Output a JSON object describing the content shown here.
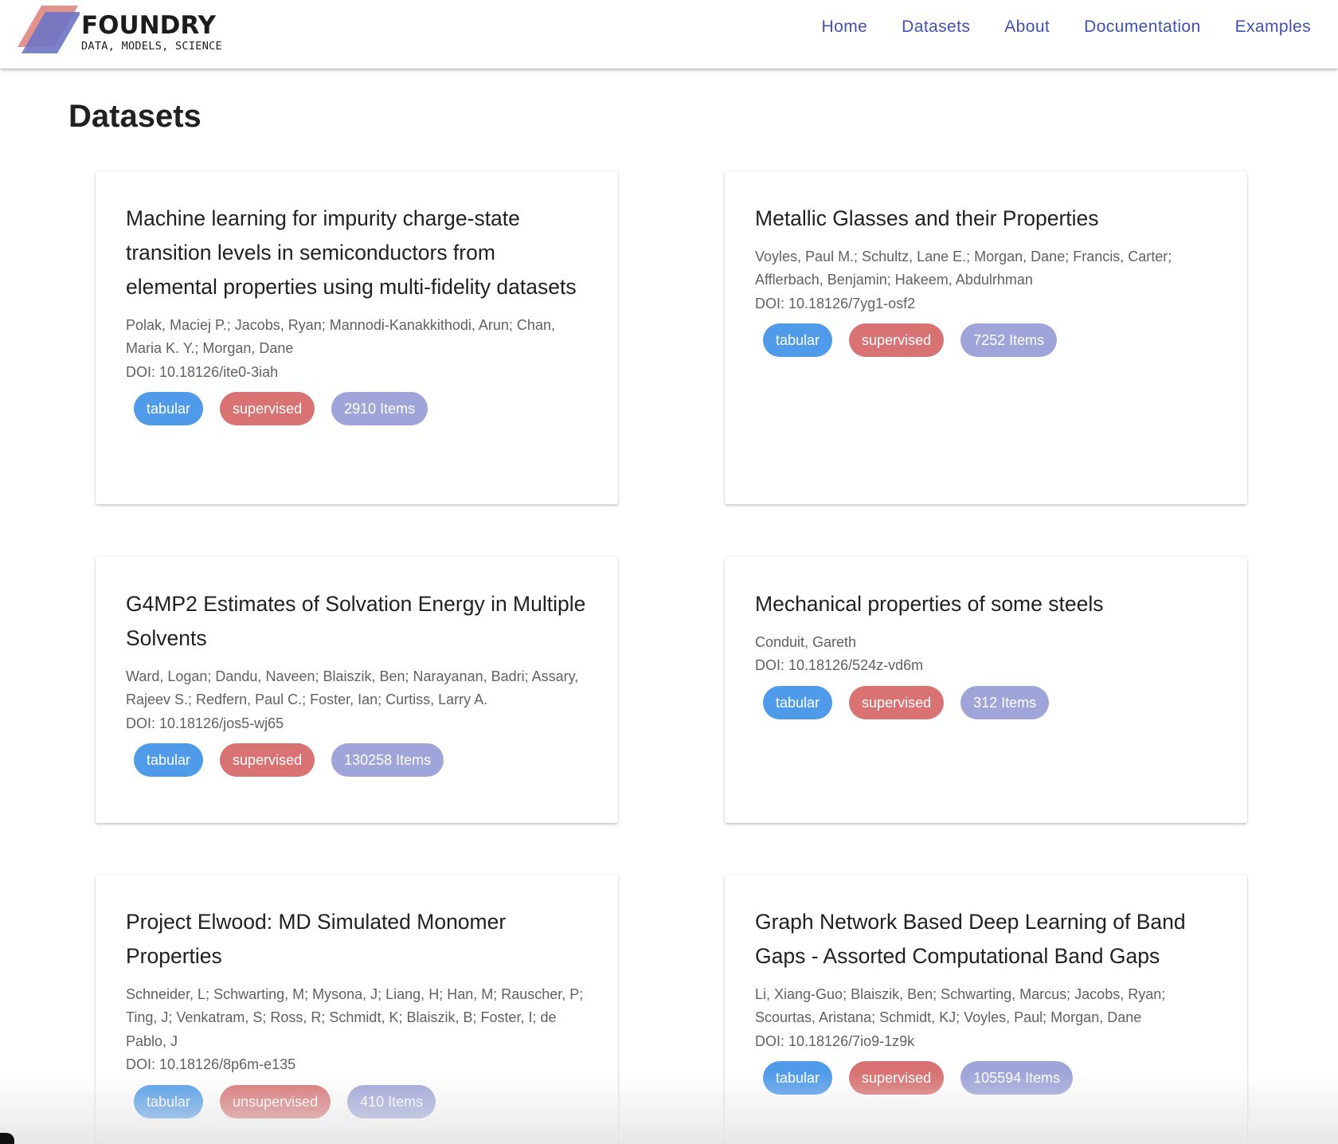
{
  "brand": {
    "name": "FOUNDRY",
    "tagline": "DATA, MODELS, SCIENCE",
    "logo_colors": [
      "#e08580",
      "#6c74c4"
    ]
  },
  "nav": {
    "links": [
      "Home",
      "Datasets",
      "About",
      "Documentation",
      "Examples"
    ]
  },
  "page": {
    "title": "Datasets"
  },
  "datasets": [
    {
      "title": "Machine learning for impurity charge-state transition levels in semiconductors from elemental properties using multi-fidelity datasets",
      "authors": "Polak, Maciej P.; Jacobs, Ryan; Mannodi-Kanakkithodi, Arun; Chan, Maria K. Y.; Morgan, Dane",
      "doi": "DOI: 10.18126/ite0-3iah",
      "type": "tabular",
      "task": "supervised",
      "items": "2910 Items"
    },
    {
      "title": "Metallic Glasses and their Properties",
      "authors": "Voyles, Paul M.; Schultz, Lane E.; Morgan, Dane; Francis, Carter; Afflerbach, Benjamin; Hakeem, Abdulrhman",
      "doi": "DOI: 10.18126/7yg1-osf2",
      "type": "tabular",
      "task": "supervised",
      "items": "7252 Items"
    },
    {
      "title": "G4MP2 Estimates of Solvation Energy in Multiple Solvents",
      "authors": "Ward, Logan; Dandu, Naveen; Blaiszik, Ben; Narayanan, Badri; Assary, Rajeev S.; Redfern, Paul C.; Foster, Ian; Curtiss, Larry A.",
      "doi": "DOI: 10.18126/jos5-wj65",
      "type": "tabular",
      "task": "supervised",
      "items": "130258 Items"
    },
    {
      "title": "Mechanical properties of some steels",
      "authors": "Conduit, Gareth",
      "doi": "DOI: 10.18126/524z-vd6m",
      "type": "tabular",
      "task": "supervised",
      "items": "312 Items"
    },
    {
      "title": "Project Elwood: MD Simulated Monomer Properties",
      "authors": "Schneider, L; Schwarting, M; Mysona, J; Liang, H; Han, M; Rauscher, P; Ting, J; Venkatram, S; Ross, R; Schmidt, K; Blaiszik, B; Foster, I; de Pablo, J",
      "doi": "DOI: 10.18126/8p6m-e135",
      "type": "tabular",
      "task": "unsupervised",
      "items": "410 Items"
    },
    {
      "title": "Graph Network Based Deep Learning of Band Gaps - Assorted Computational Band Gaps",
      "authors": "Li, Xiang-Guo; Blaiszik, Ben; Schwarting, Marcus; Jacobs, Ryan; Scourtas, Aristana; Schmidt, KJ; Voyles, Paul; Morgan, Dane",
      "doi": "DOI: 10.18126/7io9-1z9k",
      "type": "tabular",
      "task": "supervised",
      "items": "105594 Items"
    }
  ]
}
